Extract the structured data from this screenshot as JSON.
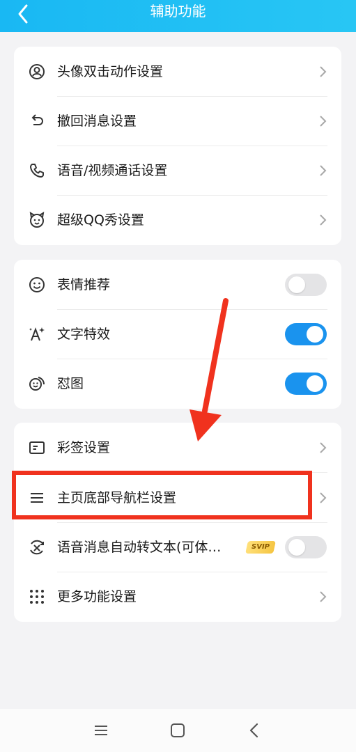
{
  "header": {
    "title": "辅助功能"
  },
  "sections": [
    {
      "items": [
        {
          "label": "头像双击动作设置",
          "icon": "avatar-icon"
        },
        {
          "label": "撤回消息设置",
          "icon": "undo-icon"
        },
        {
          "label": "语音/视频通话设置",
          "icon": "phone-icon"
        },
        {
          "label": "超级QQ秀设置",
          "icon": "qq-show-icon"
        }
      ]
    },
    {
      "items": [
        {
          "label": "表情推荐",
          "icon": "smiley-icon",
          "toggle": false
        },
        {
          "label": "文字特效",
          "icon": "text-effect-icon",
          "toggle": true
        },
        {
          "label": "怼图",
          "icon": "sticker-icon",
          "toggle": true
        }
      ]
    },
    {
      "items": [
        {
          "label": "彩签设置",
          "icon": "tag-icon"
        },
        {
          "label": "主页底部导航栏设置",
          "icon": "menu-icon"
        },
        {
          "label": "语音消息自动转文本(可体…",
          "icon": "voice-text-icon",
          "badge": "SVIP",
          "toggle": false
        },
        {
          "label": "更多功能设置",
          "icon": "grid-icon"
        }
      ]
    }
  ],
  "colors": {
    "header": "#19b8f3",
    "toggle_on": "#1a93ee",
    "highlight": "#f0321e"
  }
}
